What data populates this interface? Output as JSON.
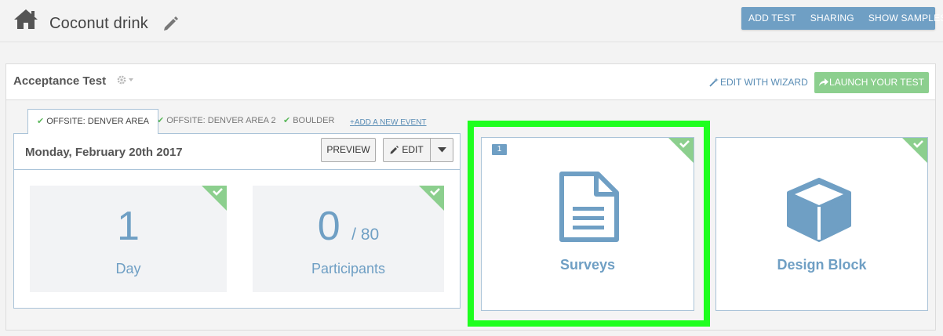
{
  "header": {
    "title": "Coconut drink",
    "actions": [
      "ADD TEST",
      "SHARING",
      "SHOW SAMPLES"
    ]
  },
  "test": {
    "name": "Acceptance Test",
    "wizard_link": "EDIT WITH WIZARD",
    "launch_button": "LAUNCH YOUR TEST"
  },
  "tabs": [
    {
      "label": "OFFSITE: DENVER AREA",
      "active": true,
      "checked": true
    },
    {
      "label": "OFFSITE: DENVER AREA 2",
      "active": false,
      "checked": true
    },
    {
      "label": "BOULDER",
      "active": false,
      "checked": true
    }
  ],
  "add_event": "ADD A NEW EVENT",
  "event": {
    "date": "Monday, February 20th 2017",
    "preview_button": "PREVIEW",
    "edit_button": "EDIT",
    "stats": [
      {
        "value": "1",
        "suffix": "",
        "label": "Day"
      },
      {
        "value": "0",
        "suffix": "/ 80",
        "label": "Participants"
      }
    ]
  },
  "blocks": [
    {
      "label": "Surveys",
      "count": "1",
      "icon": "document-icon",
      "highlighted": true
    },
    {
      "label": "Design Block",
      "count": "",
      "icon": "cube-icon",
      "highlighted": false
    }
  ],
  "colors": {
    "accent": "#6f9fc4",
    "success": "#8ccf8e",
    "check": "#5cb85c",
    "highlight": "#1eff1e"
  }
}
